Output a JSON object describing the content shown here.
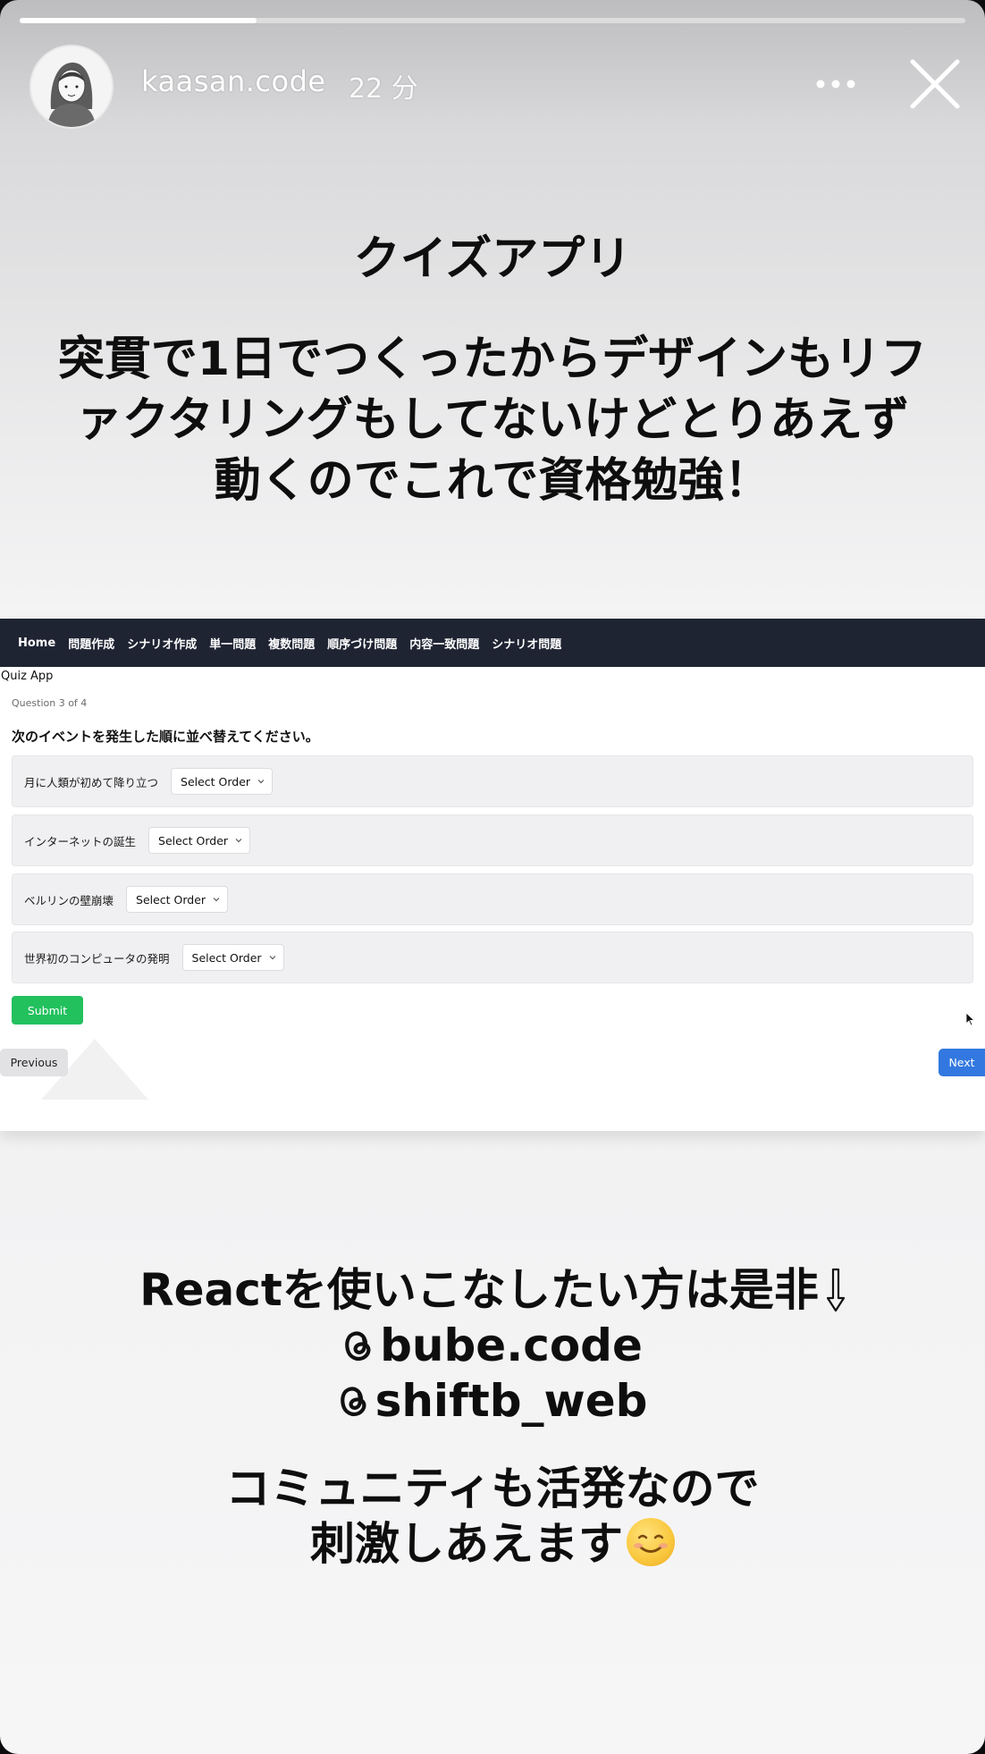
{
  "story": {
    "progress": 0.25,
    "username": "kaasan.code",
    "time_ago": "22 分"
  },
  "caption_top": {
    "title": "クイズアプリ",
    "lines": [
      "突貫で1日でつくったからデザインもリフ",
      "ァクタリングもしてないけどとりあえず",
      "動くのでこれで資格勉強！"
    ]
  },
  "app": {
    "nav": [
      "Home",
      "問題作成",
      "シナリオ作成",
      "単一問題",
      "複数問題",
      "順序づけ問題",
      "内容一致問題",
      "シナリオ問題"
    ],
    "title": "Quiz App",
    "question_count": "Question 3 of 4",
    "question": "次のイベントを発生した順に並べ替えてください。",
    "items": [
      {
        "label": "月に人類が初めて降り立つ",
        "select": "Select Order"
      },
      {
        "label": "インターネットの誕生",
        "select": "Select Order"
      },
      {
        "label": "ベルリンの壁崩壊",
        "select": "Select Order"
      },
      {
        "label": "世界初のコンピュータの発明",
        "select": "Select Order"
      }
    ],
    "submit": "Submit",
    "previous": "Previous",
    "next": "Next"
  },
  "caption_bottom": {
    "line1": "Reactを使いこなしたい方は是非",
    "line2": "bube.code",
    "line3": "shiftb_web",
    "line4": "コミュニティも活発なので",
    "line5": "刺激しあえます"
  },
  "colors": {
    "navbar": "#1f2433",
    "submit": "#22c15e",
    "next": "#3278e0",
    "previous": "#e2e2e5"
  }
}
